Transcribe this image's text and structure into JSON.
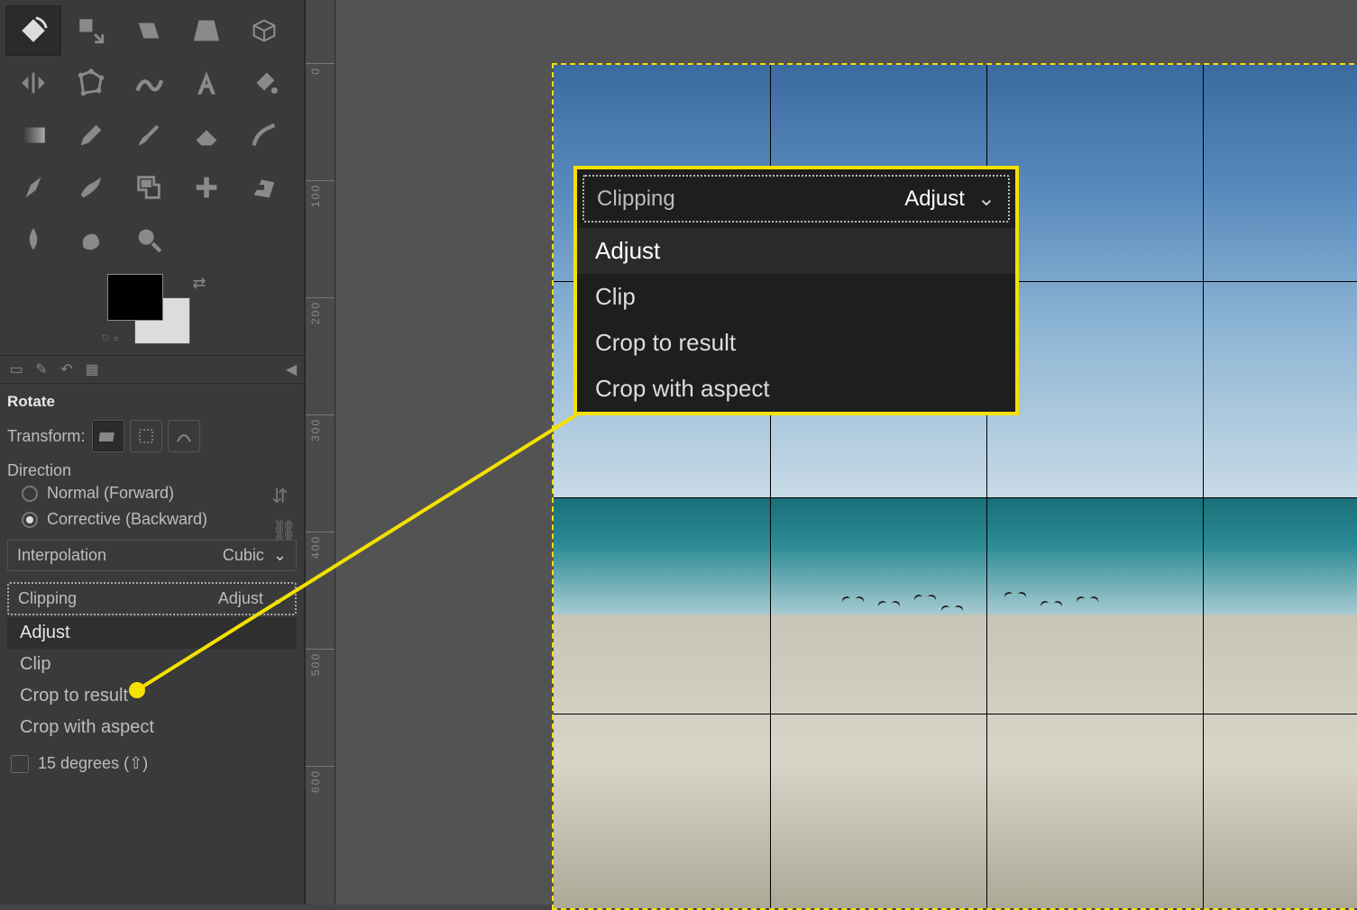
{
  "toolbox": {
    "tools": [
      "rotate-tool",
      "scale-tool",
      "shear-tool",
      "perspective-tool",
      "3d-transform-tool",
      "flip-tool",
      "cage-tool",
      "warp-tool",
      "text-tool",
      "bucket-fill-tool",
      "gradient-tool",
      "pencil-tool",
      "paintbrush-tool",
      "eraser-tool",
      "airbrush-tool",
      "ink-tool",
      "mypaint-tool",
      "clone-tool",
      "heal-tool",
      "perspective-clone-tool",
      "blur-tool",
      "smudge-tool",
      "dodge-tool"
    ],
    "active_tool_index": 0
  },
  "tabs": [
    "tool-options",
    "device-status",
    "undo-history",
    "images"
  ],
  "options": {
    "title": "Rotate",
    "transform_label": "Transform:",
    "transform_modes": [
      "layer",
      "selection",
      "path"
    ],
    "transform_selected": 0,
    "direction_label": "Direction",
    "direction_options": [
      {
        "label": "Normal (Forward)",
        "checked": false
      },
      {
        "label": "Corrective (Backward)",
        "checked": true
      }
    ],
    "interpolation": {
      "label": "Interpolation",
      "value": "Cubic"
    },
    "clipping": {
      "label": "Clipping",
      "value": "Adjust",
      "options": [
        "Adjust",
        "Clip",
        "Crop to result",
        "Crop with aspect"
      ],
      "selected_index": 0
    },
    "constrain": {
      "label": "15 degrees (⇧)",
      "checked": false
    }
  },
  "ruler": {
    "marks": [
      {
        "pos": 70,
        "label": "0"
      },
      {
        "pos": 200,
        "label": "100"
      },
      {
        "pos": 330,
        "label": "200"
      },
      {
        "pos": 460,
        "label": "300"
      },
      {
        "pos": 590,
        "label": "400"
      },
      {
        "pos": 720,
        "label": "500"
      },
      {
        "pos": 850,
        "label": "600"
      }
    ]
  },
  "callout": {
    "label": "Clipping",
    "value": "Adjust",
    "options": [
      "Adjust",
      "Clip",
      "Crop to result",
      "Crop with aspect"
    ],
    "selected_index": 0
  }
}
